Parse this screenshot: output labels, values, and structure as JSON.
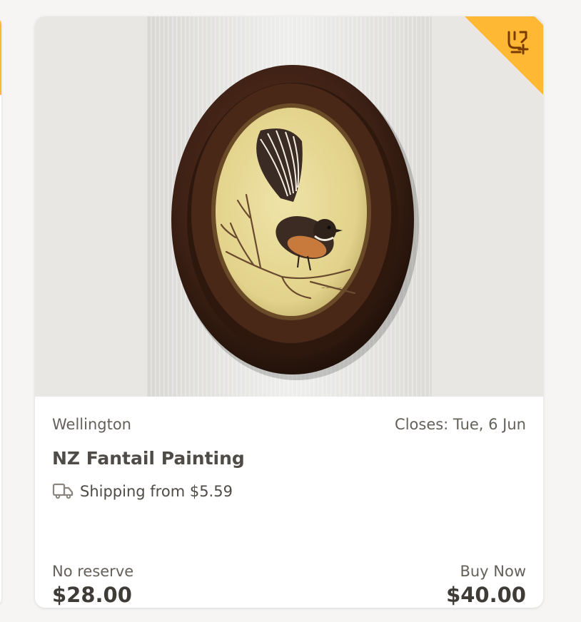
{
  "listing": {
    "location": "Wellington",
    "closes": "Closes: Tue, 6 Jun",
    "title": "NZ Fantail Painting",
    "shipping": "Shipping from $5.59",
    "price_left": {
      "label": "No reserve",
      "value": "$28.00"
    },
    "price_right": {
      "label": "Buy Now",
      "value": "$40.00"
    },
    "image_alt": "Oval framed painting of a fantail bird on a branch",
    "watchlist_icon": "watchlist-add-icon",
    "shipping_icon": "truck-icon"
  },
  "colors": {
    "accent": "#ffb833",
    "accent_icon": "#7a3b00",
    "card_bg": "#ffffff",
    "page_bg": "#f6f5f4"
  }
}
